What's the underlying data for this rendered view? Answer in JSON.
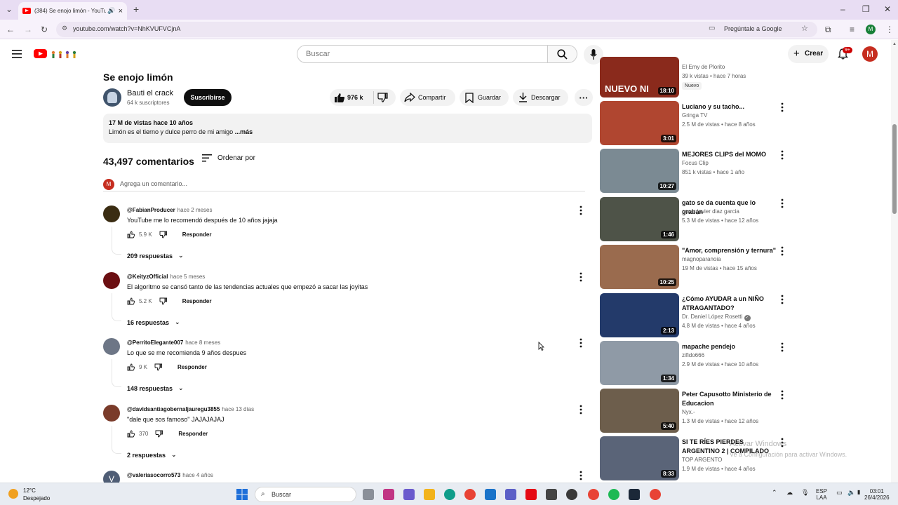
{
  "browser": {
    "tab_title": "(384) Se enojo limón - YouTube",
    "url": "youtube.com/watch?v=NhKVUFVCjnA",
    "ask_google": "Pregúntale a Google",
    "profile_initial": "M"
  },
  "header": {
    "search_placeholder": "Buscar",
    "create_label": "Crear",
    "notif_badge": "9+",
    "avatar_initial": "M"
  },
  "video": {
    "title": "Se enojo limón",
    "channel": "Bauti el crack",
    "subscribers": "64 k suscriptores",
    "subscribe_label": "Suscribirse",
    "likes": "976 k",
    "share_label": "Compartir",
    "save_label": "Guardar",
    "download_label": "Descargar",
    "views_date": "17 M de vistas  hace 10 años",
    "description": "Limón es el tierno y dulce perro de mi amigo",
    "more_label": "...más"
  },
  "comments_section": {
    "count": "43,497 comentarios",
    "sort_label": "Ordenar por",
    "add_placeholder": "Agrega un comentario...",
    "user_initial": "M",
    "reply_label": "Responder"
  },
  "comments": [
    {
      "author": "@FabianProducer",
      "when": "hace 2 meses",
      "text": "YouTube me lo recomendó después de 10 años jajaja",
      "likes": "5.9 K",
      "replies": "209 respuestas",
      "color": "#3a2c12"
    },
    {
      "author": "@KeityzOfficial",
      "when": "hace 5 meses",
      "text": "El algoritmo se cansó tanto de las tendencias actuales que empezó a sacar las joyitas",
      "likes": "5.2 K",
      "replies": "16 respuestas",
      "color": "#6b0f12"
    },
    {
      "author": "@PerritoElegante007",
      "when": "hace 8 meses",
      "text": "Lo que se me recomienda 9 años despues",
      "likes": "9 K",
      "replies": "148 respuestas",
      "color": "#6d7686"
    },
    {
      "author": "@davidsantiagobernaljauregu3855",
      "when": "hace 13 días",
      "text": "\"dale que sos famoso\" JAJAJAJAJ",
      "likes": "370",
      "replies": "2 respuestas",
      "color": "#7a3b2a"
    },
    {
      "author": "@valeriasocorro573",
      "when": "hace 4 años",
      "text": "",
      "likes": "",
      "replies": "",
      "color": "#4f5d75",
      "initial": "V"
    }
  ],
  "recommendations": [
    {
      "title": "",
      "channel": "El Emy de Plorito",
      "meta": "39 k vistas • hace 7 horas",
      "duration": "18:10",
      "badge": "Nuevo",
      "thumb": "#8a2a1c"
    },
    {
      "title": "Luciano y su tacho...",
      "channel": "Gringa TV",
      "meta": "2.5 M de vistas • hace 8 años",
      "duration": "3:01",
      "thumb": "#b04630"
    },
    {
      "title": "MEJORES CLIPS del MOMO",
      "channel": "Focus Clip",
      "meta": "851 k vistas • hace 1 año",
      "duration": "10:27",
      "thumb": "#7b8a93"
    },
    {
      "title": "gato se da cuenta que lo graban",
      "channel": "oscar javier diaz garcia",
      "meta": "5.3 M de vistas • hace 12 años",
      "duration": "1:46",
      "thumb": "#4e5348"
    },
    {
      "title": "\"Amor, comprensión y ternura\"",
      "channel": "magnoparanoia",
      "meta": "19 M de vistas • hace 15 años",
      "duration": "10:25",
      "thumb": "#9a6b4e"
    },
    {
      "title": "¿Cómo AYUDAR a un NIÑO ATRAGANTADO?",
      "channel": "Dr. Daniel López Rosetti",
      "meta": "4.8 M de vistas • hace 4 años",
      "duration": "2:13",
      "thumb": "#233a6a"
    },
    {
      "title": "mapache pendejo",
      "channel": "zifido666",
      "meta": "2.9 M de vistas • hace 10 años",
      "duration": "1:34",
      "thumb": "#8f9aa6"
    },
    {
      "title": "Peter Capusotto  Ministerio de Educacion",
      "channel": "Nyx.-",
      "meta": "1.3 M de vistas • hace 12 años",
      "duration": "5:40",
      "thumb": "#6d5e4c"
    },
    {
      "title": "SI TE RÍES PIERDES ARGENTINO 2 | COMPILADO",
      "channel": "TOP ARGENTO",
      "meta": "1.9 M de vistas • hace 4 años",
      "duration": "8:33",
      "thumb": "#5a6478"
    }
  ],
  "watermark": {
    "line1": "Activar Windows",
    "line2": "Ve a Configuración para activar Windows."
  },
  "taskbar": {
    "temp": "12°C",
    "weather": "Despejado",
    "search": "Buscar",
    "lang1": "ESP",
    "lang2": "LAA",
    "time": "03:01",
    "date": "26/4/2026"
  }
}
